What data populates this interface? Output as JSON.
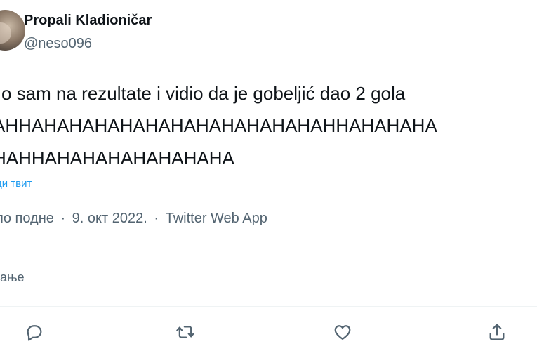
{
  "tweet": {
    "author": {
      "display_name": "Propali Kladioničar",
      "handle": "@neso096"
    },
    "text_lines": [
      "o sam na rezultate i vidio da je gobeljić dao 2 gola",
      "AHHAHAHAHAHAHAHAHAHAHAHAHAHHAHAHAHA",
      "HAHHAHAHAHAHAHAHAHA"
    ],
    "translate_label": "ди твит",
    "meta": {
      "time": "по подне",
      "date": "9. окт 2022.",
      "source": "Twitter Web App",
      "separator": "·"
    },
    "stats_label": "ђање"
  },
  "actions": [
    {
      "name": "reply",
      "icon": "reply-icon"
    },
    {
      "name": "retweet",
      "icon": "retweet-icon"
    },
    {
      "name": "like",
      "icon": "heart-icon"
    },
    {
      "name": "share",
      "icon": "share-icon"
    }
  ],
  "colors": {
    "text": "#0f1419",
    "secondary": "#536471",
    "link": "#1d9bf0",
    "divider": "#eff3f4"
  }
}
